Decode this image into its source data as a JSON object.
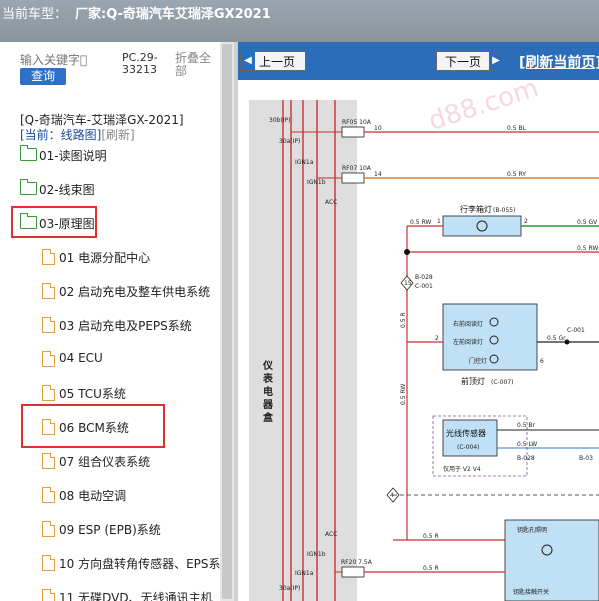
{
  "header": {
    "label": "当前车型：",
    "model": "厂家:Q-奇瑞汽车艾瑞泽GX2021"
  },
  "sidebar": {
    "search_placeholder": "输入关键字",
    "query_label": "查询",
    "pc_code": "PC.29-33213",
    "fold_label": "折叠全部",
    "breadcrumb": "[Q-奇瑞汽车-艾瑞泽GX-2021]",
    "current_label": "[当前：线路图]",
    "refresh_label": "[刷新]",
    "folders": [
      {
        "label": "01-读图说明"
      },
      {
        "label": "02-线束图"
      },
      {
        "label": "03-原理图"
      }
    ],
    "files": [
      {
        "label": "01 电源分配中心"
      },
      {
        "label": "02 启动充电及整车供电系统"
      },
      {
        "label": "03 启动充电及PEPS系统"
      },
      {
        "label": "04 ECU"
      },
      {
        "label": "05 TCU系统"
      },
      {
        "label": "06 BCM系统"
      },
      {
        "label": "07 组合仪表系统"
      },
      {
        "label": "08 电动空调"
      },
      {
        "label": "09 ESP (EPB)系统"
      },
      {
        "label": "10 方向盘转角传感器、EPS系统"
      },
      {
        "label": "11 无碟DVD、无线通讯主机"
      }
    ]
  },
  "viewer": {
    "prev_label": "上一页",
    "next_label": "下一页",
    "refresh_label": "[刷新当前页]",
    "watermark": "d88.com",
    "side_label": "仪表电器盒",
    "fuses": [
      "RF05 10A",
      "RF07 10A",
      "RF20 7.5A"
    ],
    "pins": [
      "30b(IP)",
      "30a(IP)",
      "IGN1a",
      "IGN1b",
      "ACC",
      "ACC",
      "IGN1b",
      "IGN1a",
      "30a(IP)"
    ],
    "wires": [
      "0.5 BL",
      "0.5 RY",
      "0.5 RW",
      "0.5 GV",
      "0.5 RW",
      "0.5 R",
      "0.5 Br",
      "0.5 LW",
      "0.5 Gr",
      "0.5 RW",
      "0.5 R"
    ],
    "trunk_lamp": "行李箱灯",
    "trunk_lamp_code": "(B-055)",
    "dome_lamp": "前顶灯",
    "dome_lamp_code": "(C-007)",
    "right_reading_lamp": "右前阅读灯",
    "left_reading_lamp": "左前阅读灯",
    "dome_light": "门控灯",
    "light_sensor": "光线传感器",
    "light_sensor_code": "(C-004)",
    "light_sensor_note": "仅用于 V2 V4",
    "key_hole_lamp": "钥匙孔照明",
    "key_switch": "钥匙接触开关",
    "connectors": [
      "B-028",
      "C-001",
      "C-001",
      "B-028",
      "B-03"
    ],
    "pin_numbers": [
      "10",
      "14",
      "1",
      "2",
      "2",
      "1",
      "15",
      "4",
      "3",
      "6",
      "5",
      "2",
      "1",
      "4",
      "1",
      "2",
      "3",
      "2",
      "1",
      "3"
    ]
  },
  "colors": {
    "nav": "#2b6db8",
    "title": "#8f9aa3",
    "highlight": "#e03030",
    "wire_red": "#c83030",
    "wire_green": "#2a9a3a",
    "wire_orange": "#e07a30",
    "lamp_fill": "#bfe0f5"
  }
}
